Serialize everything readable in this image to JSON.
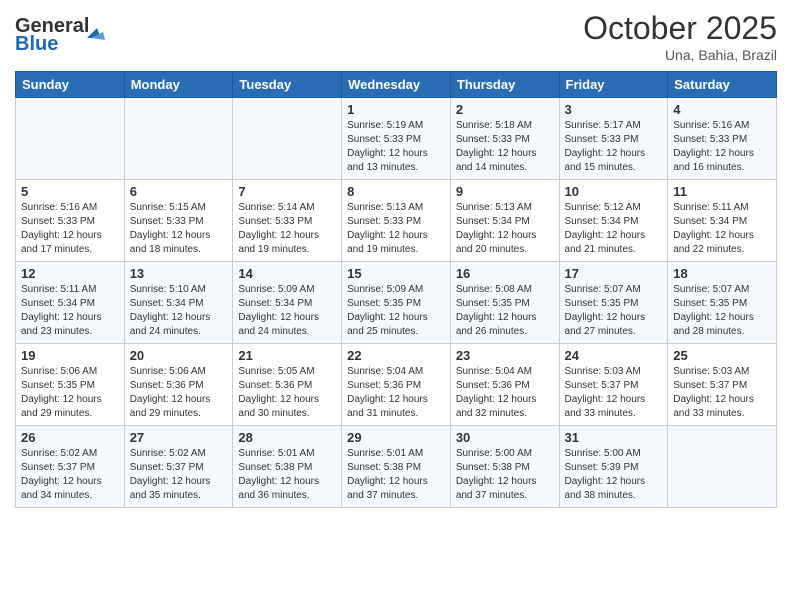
{
  "header": {
    "logo_line1": "General",
    "logo_line2": "Blue",
    "month": "October 2025",
    "location": "Una, Bahia, Brazil"
  },
  "weekdays": [
    "Sunday",
    "Monday",
    "Tuesday",
    "Wednesday",
    "Thursday",
    "Friday",
    "Saturday"
  ],
  "weeks": [
    [
      {
        "day": "",
        "detail": ""
      },
      {
        "day": "",
        "detail": ""
      },
      {
        "day": "",
        "detail": ""
      },
      {
        "day": "1",
        "detail": "Sunrise: 5:19 AM\nSunset: 5:33 PM\nDaylight: 12 hours\nand 13 minutes."
      },
      {
        "day": "2",
        "detail": "Sunrise: 5:18 AM\nSunset: 5:33 PM\nDaylight: 12 hours\nand 14 minutes."
      },
      {
        "day": "3",
        "detail": "Sunrise: 5:17 AM\nSunset: 5:33 PM\nDaylight: 12 hours\nand 15 minutes."
      },
      {
        "day": "4",
        "detail": "Sunrise: 5:16 AM\nSunset: 5:33 PM\nDaylight: 12 hours\nand 16 minutes."
      }
    ],
    [
      {
        "day": "5",
        "detail": "Sunrise: 5:16 AM\nSunset: 5:33 PM\nDaylight: 12 hours\nand 17 minutes."
      },
      {
        "day": "6",
        "detail": "Sunrise: 5:15 AM\nSunset: 5:33 PM\nDaylight: 12 hours\nand 18 minutes."
      },
      {
        "day": "7",
        "detail": "Sunrise: 5:14 AM\nSunset: 5:33 PM\nDaylight: 12 hours\nand 19 minutes."
      },
      {
        "day": "8",
        "detail": "Sunrise: 5:13 AM\nSunset: 5:33 PM\nDaylight: 12 hours\nand 19 minutes."
      },
      {
        "day": "9",
        "detail": "Sunrise: 5:13 AM\nSunset: 5:34 PM\nDaylight: 12 hours\nand 20 minutes."
      },
      {
        "day": "10",
        "detail": "Sunrise: 5:12 AM\nSunset: 5:34 PM\nDaylight: 12 hours\nand 21 minutes."
      },
      {
        "day": "11",
        "detail": "Sunrise: 5:11 AM\nSunset: 5:34 PM\nDaylight: 12 hours\nand 22 minutes."
      }
    ],
    [
      {
        "day": "12",
        "detail": "Sunrise: 5:11 AM\nSunset: 5:34 PM\nDaylight: 12 hours\nand 23 minutes."
      },
      {
        "day": "13",
        "detail": "Sunrise: 5:10 AM\nSunset: 5:34 PM\nDaylight: 12 hours\nand 24 minutes."
      },
      {
        "day": "14",
        "detail": "Sunrise: 5:09 AM\nSunset: 5:34 PM\nDaylight: 12 hours\nand 24 minutes."
      },
      {
        "day": "15",
        "detail": "Sunrise: 5:09 AM\nSunset: 5:35 PM\nDaylight: 12 hours\nand 25 minutes."
      },
      {
        "day": "16",
        "detail": "Sunrise: 5:08 AM\nSunset: 5:35 PM\nDaylight: 12 hours\nand 26 minutes."
      },
      {
        "day": "17",
        "detail": "Sunrise: 5:07 AM\nSunset: 5:35 PM\nDaylight: 12 hours\nand 27 minutes."
      },
      {
        "day": "18",
        "detail": "Sunrise: 5:07 AM\nSunset: 5:35 PM\nDaylight: 12 hours\nand 28 minutes."
      }
    ],
    [
      {
        "day": "19",
        "detail": "Sunrise: 5:06 AM\nSunset: 5:35 PM\nDaylight: 12 hours\nand 29 minutes."
      },
      {
        "day": "20",
        "detail": "Sunrise: 5:06 AM\nSunset: 5:36 PM\nDaylight: 12 hours\nand 29 minutes."
      },
      {
        "day": "21",
        "detail": "Sunrise: 5:05 AM\nSunset: 5:36 PM\nDaylight: 12 hours\nand 30 minutes."
      },
      {
        "day": "22",
        "detail": "Sunrise: 5:04 AM\nSunset: 5:36 PM\nDaylight: 12 hours\nand 31 minutes."
      },
      {
        "day": "23",
        "detail": "Sunrise: 5:04 AM\nSunset: 5:36 PM\nDaylight: 12 hours\nand 32 minutes."
      },
      {
        "day": "24",
        "detail": "Sunrise: 5:03 AM\nSunset: 5:37 PM\nDaylight: 12 hours\nand 33 minutes."
      },
      {
        "day": "25",
        "detail": "Sunrise: 5:03 AM\nSunset: 5:37 PM\nDaylight: 12 hours\nand 33 minutes."
      }
    ],
    [
      {
        "day": "26",
        "detail": "Sunrise: 5:02 AM\nSunset: 5:37 PM\nDaylight: 12 hours\nand 34 minutes."
      },
      {
        "day": "27",
        "detail": "Sunrise: 5:02 AM\nSunset: 5:37 PM\nDaylight: 12 hours\nand 35 minutes."
      },
      {
        "day": "28",
        "detail": "Sunrise: 5:01 AM\nSunset: 5:38 PM\nDaylight: 12 hours\nand 36 minutes."
      },
      {
        "day": "29",
        "detail": "Sunrise: 5:01 AM\nSunset: 5:38 PM\nDaylight: 12 hours\nand 37 minutes."
      },
      {
        "day": "30",
        "detail": "Sunrise: 5:00 AM\nSunset: 5:38 PM\nDaylight: 12 hours\nand 37 minutes."
      },
      {
        "day": "31",
        "detail": "Sunrise: 5:00 AM\nSunset: 5:39 PM\nDaylight: 12 hours\nand 38 minutes."
      },
      {
        "day": "",
        "detail": ""
      }
    ]
  ]
}
